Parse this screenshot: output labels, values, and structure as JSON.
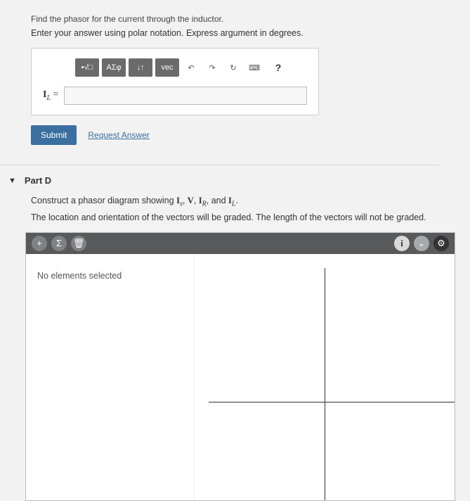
{
  "instruction_line1": "Find the phasor for the current through the inductor.",
  "instruction_line2": "Enter your answer using polar notation. Express argument in degrees.",
  "toolbar": {
    "template": "▪√□",
    "greek": "ΑΣφ",
    "updown": "↓↑",
    "vec": "vec",
    "undo": "↶",
    "redo": "↷",
    "reset": "↻",
    "keyboard": "⌨",
    "help": "?"
  },
  "equation": {
    "label_base": "I",
    "label_sub": "L",
    "equals": " =",
    "value": ""
  },
  "actions": {
    "submit": "Submit",
    "request": "Request Answer"
  },
  "part_d": {
    "title": "Part D",
    "instruction1_prefix": "Construct a phasor diagram showing ",
    "vec_Is_base": "I",
    "vec_Is_sub": "s",
    "vec_V": "V",
    "vec_IR_base": "I",
    "vec_IR_sub": "R",
    "vec_IL_base": "I",
    "vec_IL_sub": "L",
    "instruction2": "The location and orientation of the vectors will be graded. The length of the vectors will not be graded.",
    "props_text": "No elements selected",
    "dtool_add": "+",
    "dtool_sum": "Σ",
    "dtool_del": "🗑",
    "dtool_info": "i",
    "dtool_chev": "⌄",
    "dtool_gear": "⚙"
  }
}
